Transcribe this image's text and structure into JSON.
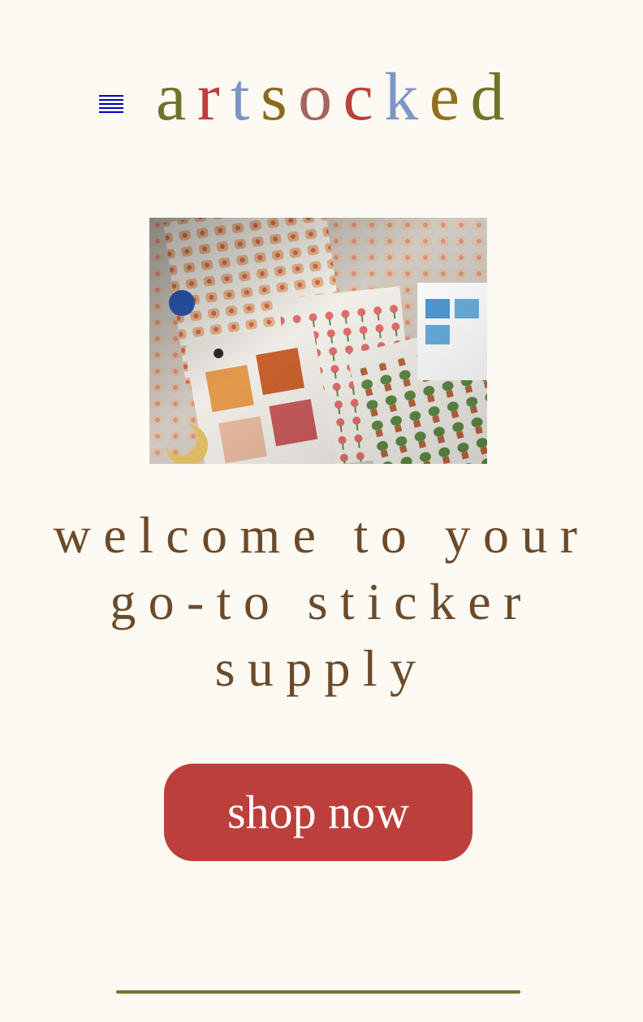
{
  "header": {
    "menu_icon": "hamburger-menu-icon",
    "brand_letters": [
      "a",
      "r",
      "t",
      "s",
      "o",
      "c",
      "k",
      "e",
      "d"
    ],
    "brand_colors": [
      "#6f7428",
      "#bd3f3b",
      "#7d95c7",
      "#8b6a1f",
      "#a6655d",
      "#bd3f3b",
      "#7d95c7",
      "#93701f",
      "#6f7428"
    ]
  },
  "hero": {
    "headline_lines": [
      "welcome to your",
      "go-to sticker",
      "supply"
    ]
  },
  "cta": {
    "label": "shop now"
  },
  "colors": {
    "background": "#fdfaf3",
    "headline": "#6b4a2b",
    "button": "#bd3f3b",
    "divider": "#6f7428",
    "menu_icon": "#0000cc"
  }
}
